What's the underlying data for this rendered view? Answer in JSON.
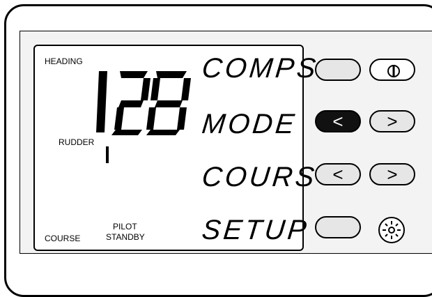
{
  "lcd": {
    "heading_label": "HEADING",
    "heading_value": "128",
    "rudder_label": "RUDDER",
    "course_label": "COURSE",
    "pilot_label": "PILOT",
    "standby_label": "STANDBY"
  },
  "menu": {
    "comps": "COMPS",
    "mode": "MODE",
    "cours": "COURS",
    "setup": "SETUP"
  },
  "buttons": {
    "blank_top": "",
    "power": "power-icon",
    "mode_left": "<",
    "mode_right": ">",
    "cours_left": "<",
    "cours_right": ">",
    "blank_bottom": "",
    "brightness": "sun-icon"
  },
  "colors": {
    "lcd_bg": "#ffffff",
    "panel_bg": "#f3f3f3",
    "button_fill": "#e6e6e6",
    "active_button": "#111111"
  }
}
